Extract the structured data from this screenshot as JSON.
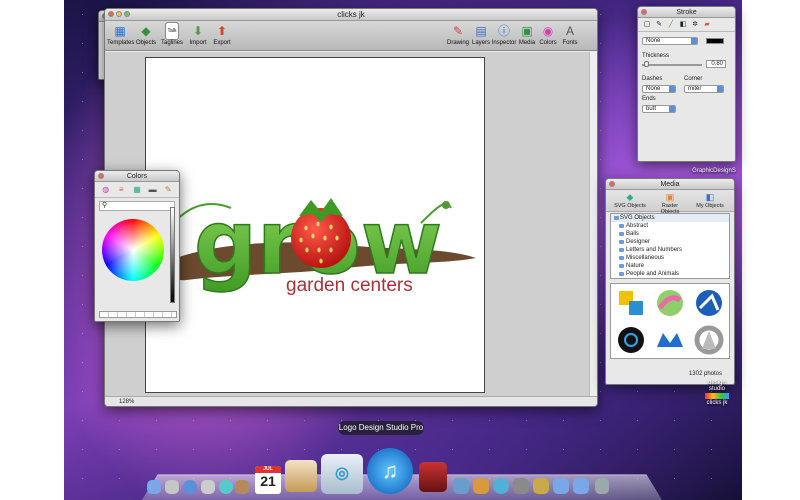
{
  "main_window": {
    "title": "clicks jk",
    "toolbar": {
      "left": [
        {
          "label": "Templates",
          "icon": "templates-icon"
        },
        {
          "label": "Objects",
          "icon": "objects-icon"
        },
        {
          "label": "Taglines",
          "icon": "taglines-icon"
        },
        {
          "label": "Import",
          "icon": "import-icon"
        },
        {
          "label": "Export",
          "icon": "export-icon"
        }
      ],
      "right": [
        {
          "label": "Drawing",
          "icon": "drawing-icon"
        },
        {
          "label": "Layers",
          "icon": "layers-icon"
        },
        {
          "label": "Inspector",
          "icon": "inspector-icon"
        },
        {
          "label": "Media",
          "icon": "media-icon"
        },
        {
          "label": "Colors",
          "icon": "colors-icon"
        },
        {
          "label": "Fonts",
          "icon": "fonts-icon"
        }
      ],
      "tag_badge": "Talk"
    },
    "zoom": "128%",
    "logo": {
      "word": "grow",
      "subtitle": "garden centers",
      "colors": {
        "green": "#5cb82e",
        "strawberry": "#d8221e",
        "soil": "#6b4a2e",
        "subtitle": "#a8323a"
      }
    }
  },
  "colors_panel": {
    "title": "Colors",
    "search_icon": "magnifier-icon"
  },
  "stroke_panel": {
    "title": "Stroke",
    "style_value": "None",
    "thickness_label": "Thickness",
    "thickness_value": "0.80",
    "dashes_label": "Dashes",
    "dashes_value": "None",
    "corner_label": "Corner",
    "corner_value": "miter",
    "ends_label": "Ends",
    "ends_value": "butt"
  },
  "media_panel": {
    "title": "Media",
    "tabs": [
      "SVG Objects",
      "Raster Objects",
      "My Objects"
    ],
    "list_header": "SVG Objects",
    "items": [
      "Abstract",
      "Balls",
      "Designer",
      "Letters and Numbers",
      "Miscellaneous",
      "Nature",
      "People and Animals"
    ],
    "photo_count": "1302 photos"
  },
  "desktop": {
    "top_label": "GraphicDesignS",
    "app_icon_line1": "design",
    "app_icon_line2": "studio",
    "app_icon_label": "clicks jk"
  },
  "dock": {
    "tooltip": "Logo Design Studio Pro",
    "calendar_month": "JUL",
    "calendar_day": "21"
  }
}
